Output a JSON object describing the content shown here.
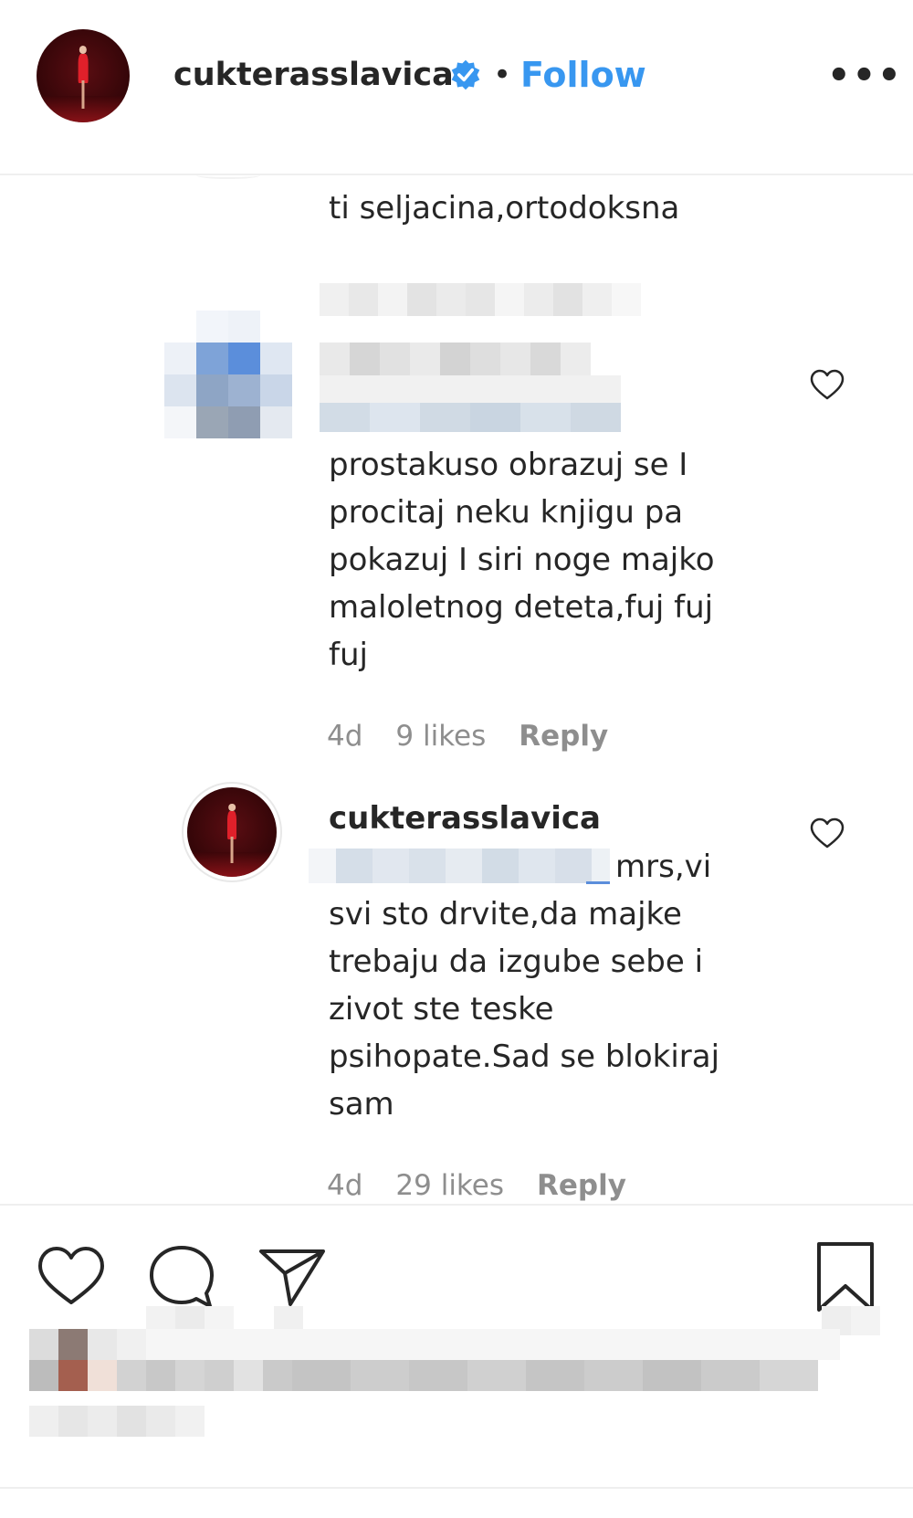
{
  "header": {
    "username": "cukterasslavica",
    "separator": "•",
    "follow_label": "Follow",
    "more_label": "•••"
  },
  "comments": [
    {
      "text": "ti seljacina,ortodoksna"
    },
    {
      "text": "prostakuso obrazuj se I\nprocitaj neku knjigu pa\npokazuj I siri noge majko\nmaloletnog deteta,fuj fuj\nfuj",
      "time": "4d",
      "likes": "9 likes",
      "reply_label": "Reply"
    },
    {
      "username": "cukterasslavica",
      "text_first_line": "mrs,vi",
      "text_rest": "svi sto drvite,da majke\ntrebaju da izgube sebe i\nzivot ste teske\npsihopate.Sad se blokiraj\nsam",
      "time": "4d",
      "likes": "29 likes",
      "reply_label": "Reply"
    }
  ],
  "icons": {
    "like": "heart-icon",
    "comment": "comment-bubble-icon",
    "share": "paper-plane-icon",
    "save": "bookmark-icon",
    "verified": "verified-badge-icon",
    "comment_like": "heart-outline-icon"
  },
  "colors": {
    "accent": "#3897f0",
    "text": "#262626",
    "meta": "#8e8e8e"
  }
}
